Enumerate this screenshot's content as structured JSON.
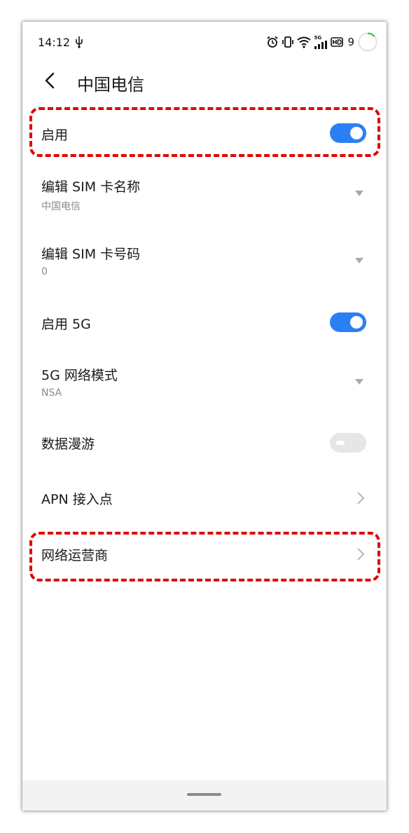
{
  "status_bar": {
    "time": "14:12",
    "network_label": "5G",
    "battery": "9",
    "icons": [
      "usb-icon",
      "alarm-icon",
      "vibrate-icon",
      "wifi-icon",
      "signal-icon",
      "hd-icon",
      "battery-ring-icon"
    ]
  },
  "header": {
    "title": "中国电信",
    "back_icon": "chevron-left-icon"
  },
  "settings": {
    "enable": {
      "label": "启用",
      "state": "on"
    },
    "edit_name": {
      "label": "编辑 SIM 卡名称",
      "value": "中国电信"
    },
    "edit_number": {
      "label": "编辑 SIM 卡号码",
      "value": "0"
    },
    "enable_5g": {
      "label": "启用 5G",
      "state": "on"
    },
    "network_mode": {
      "label": "5G 网络模式",
      "value": "NSA"
    },
    "data_roaming": {
      "label": "数据漫游",
      "state": "disabled"
    },
    "apn": {
      "label": "APN 接入点"
    },
    "carrier": {
      "label": "网络运营商"
    }
  },
  "colors": {
    "accent": "#2a7ff5",
    "highlight": "#e00000",
    "secondary_text": "#8a8a8a",
    "toggle_disabled": "#e6e6e6"
  }
}
